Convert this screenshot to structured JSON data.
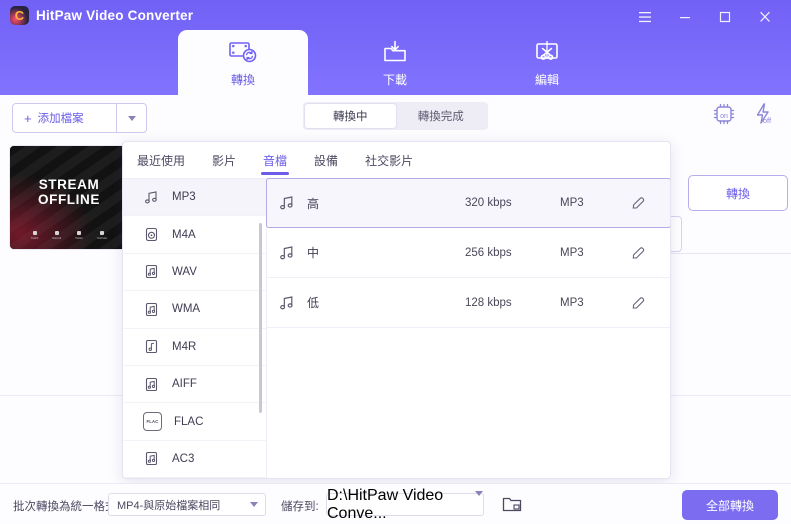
{
  "window": {
    "app_title": "HitPaw Video Converter",
    "logo_glyph": "C",
    "controls": [
      {
        "name": "menu-button",
        "icon": "hamburger-icon"
      },
      {
        "name": "minimize-button",
        "icon": "minimize-icon"
      },
      {
        "name": "maximize-button",
        "icon": "maximize-icon"
      },
      {
        "name": "close-button",
        "icon": "close-icon"
      }
    ]
  },
  "main_tabs": [
    {
      "label": "轉換",
      "icon": "film-convert-icon",
      "active": true
    },
    {
      "label": "下載",
      "icon": "download-folder-icon",
      "active": false
    },
    {
      "label": "編輯",
      "icon": "edit-screen-icon",
      "active": false
    }
  ],
  "toolbar": {
    "add_file_label": "添加檔案",
    "add_file_plus": "+",
    "segments": [
      {
        "label": "轉換中",
        "active": true
      },
      {
        "label": "轉換完成",
        "active": false
      }
    ],
    "accel_icons": [
      {
        "name": "hardware-acceleration-on-icon",
        "state": "on"
      },
      {
        "name": "lightning-acceleration-off-icon",
        "state": "off"
      }
    ]
  },
  "file_card": {
    "thumb_line1": "STREAM",
    "thumb_line2": "OFFLINE",
    "thumb_labels": [
      "Twitch",
      "Discord",
      "Twitter",
      "YouTube"
    ]
  },
  "convert_button_label": "轉換",
  "panel": {
    "tabs": [
      {
        "label": "最近使用",
        "active": false
      },
      {
        "label": "影片",
        "active": false
      },
      {
        "label": "音檔",
        "active": true
      },
      {
        "label": "設備",
        "active": false
      },
      {
        "label": "社交影片",
        "active": false
      }
    ],
    "formats": [
      {
        "label": "MP3",
        "icon": "music-note-icon",
        "selected": true
      },
      {
        "label": "M4A",
        "icon": "audio-disc-icon",
        "selected": false
      },
      {
        "label": "WAV",
        "icon": "audio-file-icon",
        "selected": false
      },
      {
        "label": "WMA",
        "icon": "audio-file-icon",
        "selected": false
      },
      {
        "label": "M4R",
        "icon": "ringtone-file-icon",
        "selected": false
      },
      {
        "label": "AIFF",
        "icon": "audio-file-icon",
        "selected": false
      },
      {
        "label": "FLAC",
        "icon": "flac-badge-icon",
        "selected": false
      },
      {
        "label": "AC3",
        "icon": "audio-file-icon",
        "selected": false
      }
    ],
    "qualities": [
      {
        "name": "高",
        "bitrate": "320 kbps",
        "format": "MP3",
        "selected": true
      },
      {
        "name": "中",
        "bitrate": "256 kbps",
        "format": "MP3",
        "selected": false
      },
      {
        "name": "低",
        "bitrate": "128 kbps",
        "format": "MP3",
        "selected": false
      }
    ],
    "edit_icon": "pencil-edit-icon"
  },
  "bottom": {
    "batch_label": "批次轉換為統一格式:",
    "batch_value": "MP4-與原始檔案相同",
    "save_label": "儲存到:",
    "save_value": "D:\\HitPaw Video Conve...",
    "folder_icon": "open-folder-icon",
    "convert_all_label": "全部轉換"
  },
  "colors": {
    "brand_purple": "#7161f5",
    "accent": "#6c5ce7",
    "convert_all_bg": "#7b6cf0",
    "panel_border": "#e6e3f2"
  }
}
